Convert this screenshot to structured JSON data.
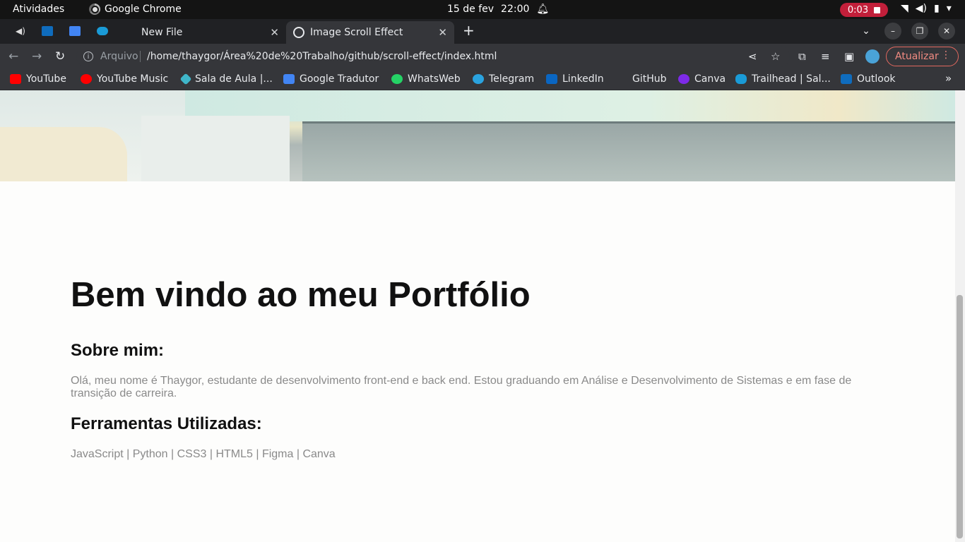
{
  "os": {
    "activities": "Atividades",
    "app_name": "Google Chrome",
    "date": "15 de fev",
    "time": "22:00",
    "recording_time": "0:03"
  },
  "tabs": [
    {
      "label": "New File"
    },
    {
      "label": "Image Scroll Effect"
    }
  ],
  "address_bar": {
    "scheme_label": "Arquivo",
    "url": "/home/thaygor/Área%20de%20Trabalho/github/scroll-effect/index.html",
    "update_label": "Atualizar"
  },
  "bookmarks": [
    {
      "label": "YouTube",
      "color": "#ff0000"
    },
    {
      "label": "YouTube Music",
      "color": "#ff0000"
    },
    {
      "label": "Sala de Aula |...",
      "color": "#3fb6c9"
    },
    {
      "label": "Google Tradutor",
      "color": "#4285f4"
    },
    {
      "label": "WhatsWeb",
      "color": "#25d366"
    },
    {
      "label": "Telegram",
      "color": "#2aa3df"
    },
    {
      "label": "LinkedIn",
      "color": "#0a66c2"
    },
    {
      "label": "GitHub",
      "color": "#35363a"
    },
    {
      "label": "Canva",
      "color": "#7d2ae8"
    },
    {
      "label": "Trailhead | Sal...",
      "color": "#1a9bd7"
    },
    {
      "label": "Outlook",
      "color": "#0f6cbd"
    }
  ],
  "page": {
    "title": "Bem vindo ao meu Portfólio",
    "about_heading": "Sobre mim:",
    "about_text": "Olá, meu nome é Thaygor, estudante de desenvolvimento front-end e back end. Estou graduando em Análise e Desenvolvimento de Sistemas e em fase de transição de carreira.",
    "tools_heading": "Ferramentas Utilizadas:",
    "tools_text": "JavaScript | Python | CSS3 | HTML5 | Figma | Canva"
  }
}
